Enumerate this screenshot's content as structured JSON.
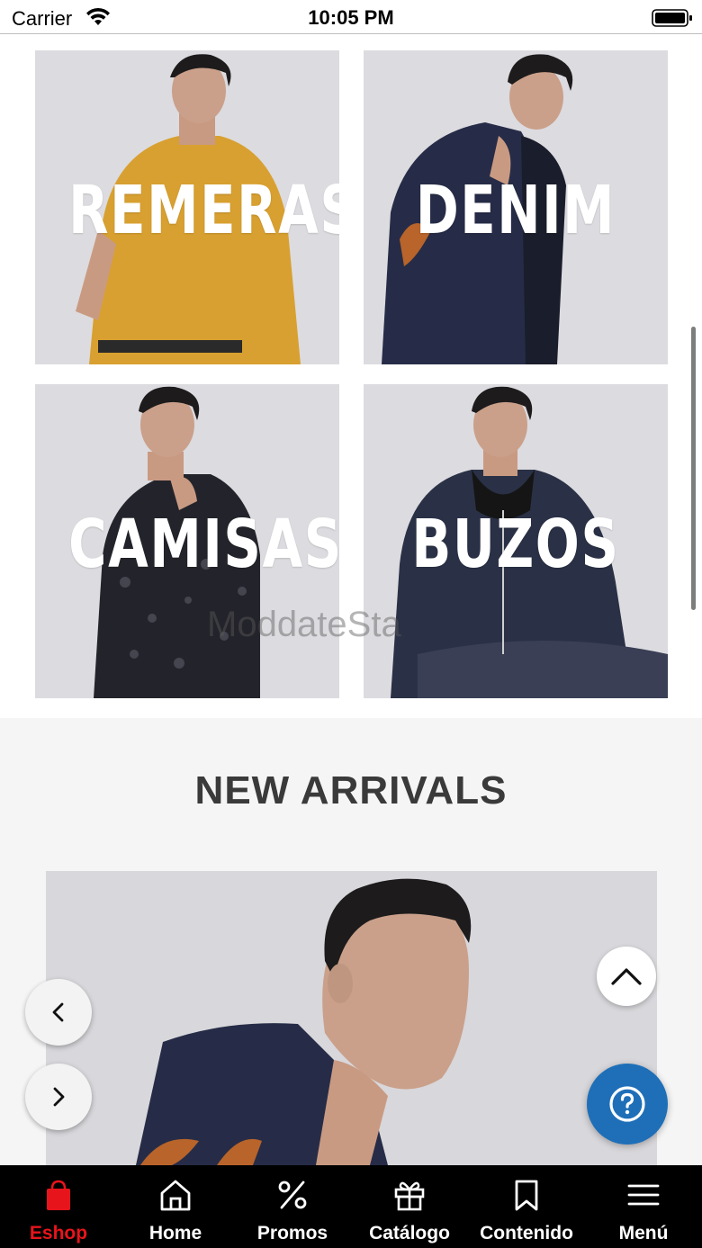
{
  "status_bar": {
    "carrier": "Carrier",
    "time": "10:05 PM"
  },
  "categories": [
    {
      "label": "REMERAS",
      "shirt_color": "#d8a030"
    },
    {
      "label": "DENIM",
      "shirt_color": "#262c47"
    },
    {
      "label": "CAMISAS",
      "shirt_color": "#23242b"
    },
    {
      "label": "BUZOS",
      "shirt_color": "#2a3146"
    }
  ],
  "watermark": "ModdateSta",
  "new_arrivals": {
    "title": "NEW ARRIVALS"
  },
  "bottom_nav": {
    "items": [
      {
        "label": "Eshop",
        "icon": "shopping-bag-icon",
        "active": true
      },
      {
        "label": "Home",
        "icon": "home-icon",
        "active": false
      },
      {
        "label": "Promos",
        "icon": "percent-icon",
        "active": false
      },
      {
        "label": "Catálogo",
        "icon": "gift-icon",
        "active": false
      },
      {
        "label": "Contenido",
        "icon": "bookmark-icon",
        "active": false
      },
      {
        "label": "Menú",
        "icon": "menu-icon",
        "active": false
      }
    ]
  },
  "colors": {
    "accent": "#e8141b",
    "help_button": "#1e6fb8",
    "nav_background": "#000000"
  }
}
